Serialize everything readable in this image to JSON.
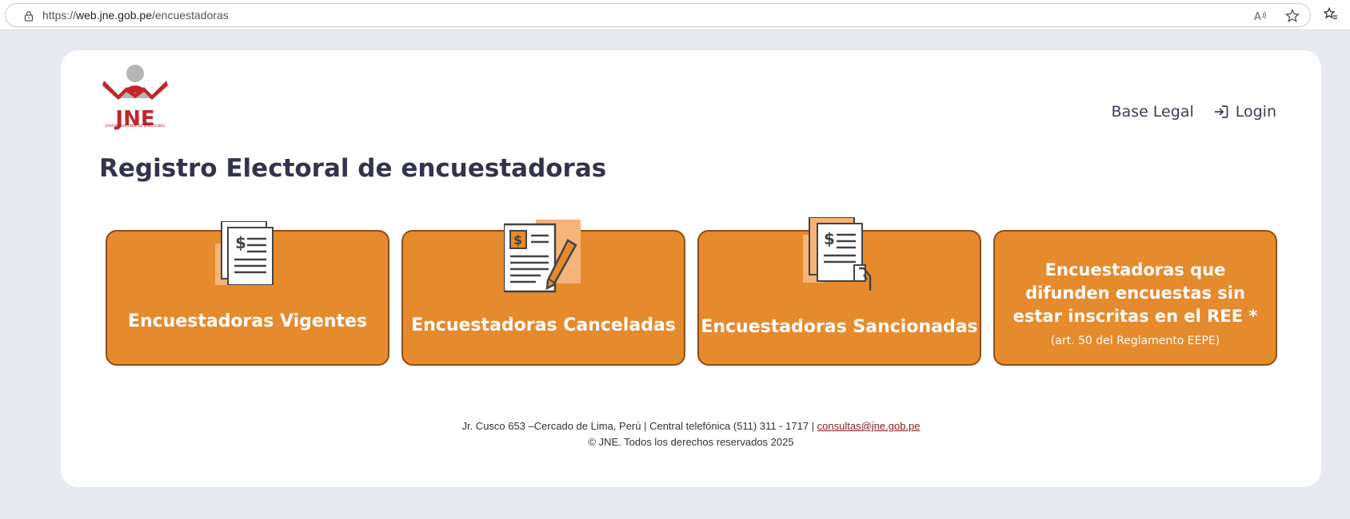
{
  "browser": {
    "url_scheme": "https://",
    "url_host": "web.jne.gob.pe",
    "url_path": "/encuestadoras",
    "icons": [
      "lock-icon",
      "read-aloud-icon",
      "favorite-star-icon",
      "favorites-list-icon"
    ]
  },
  "header": {
    "logo_text": "JNE",
    "logo_caption": "JURADO NACIONAL DE ELECCIONES",
    "nav": {
      "base_legal": "Base Legal",
      "login": "Login"
    }
  },
  "main": {
    "title": "Registro Electoral de encuestadoras",
    "tiles": [
      {
        "label": "Encuestadoras Vigentes",
        "icon": "documents-dollar-icon"
      },
      {
        "label": "Encuestadoras Canceladas",
        "icon": "document-pencil-icon"
      },
      {
        "label": "Encuestadoras Sancionadas",
        "icon": "documents-hand-icon"
      },
      {
        "label": "Encuestadoras que difunden encuestas sin estar inscritas en el REE *",
        "sub": "(art. 50 del Reglamento EEPE)"
      }
    ]
  },
  "footer": {
    "address": "Jr. Cusco 653 –Cercado de Lima, Perú | Central telefónica (511) 311 - 1717 |",
    "email": "consultas@jne.gob.pe",
    "copyright": "© JNE. Todos los derechos reservados 2025"
  },
  "colors": {
    "tile_bg": "#e68a2e",
    "tile_border": "#8c4f16",
    "title": "#33334d",
    "logo_red": "#c0262c",
    "page_bg": "#e6e9f0"
  }
}
